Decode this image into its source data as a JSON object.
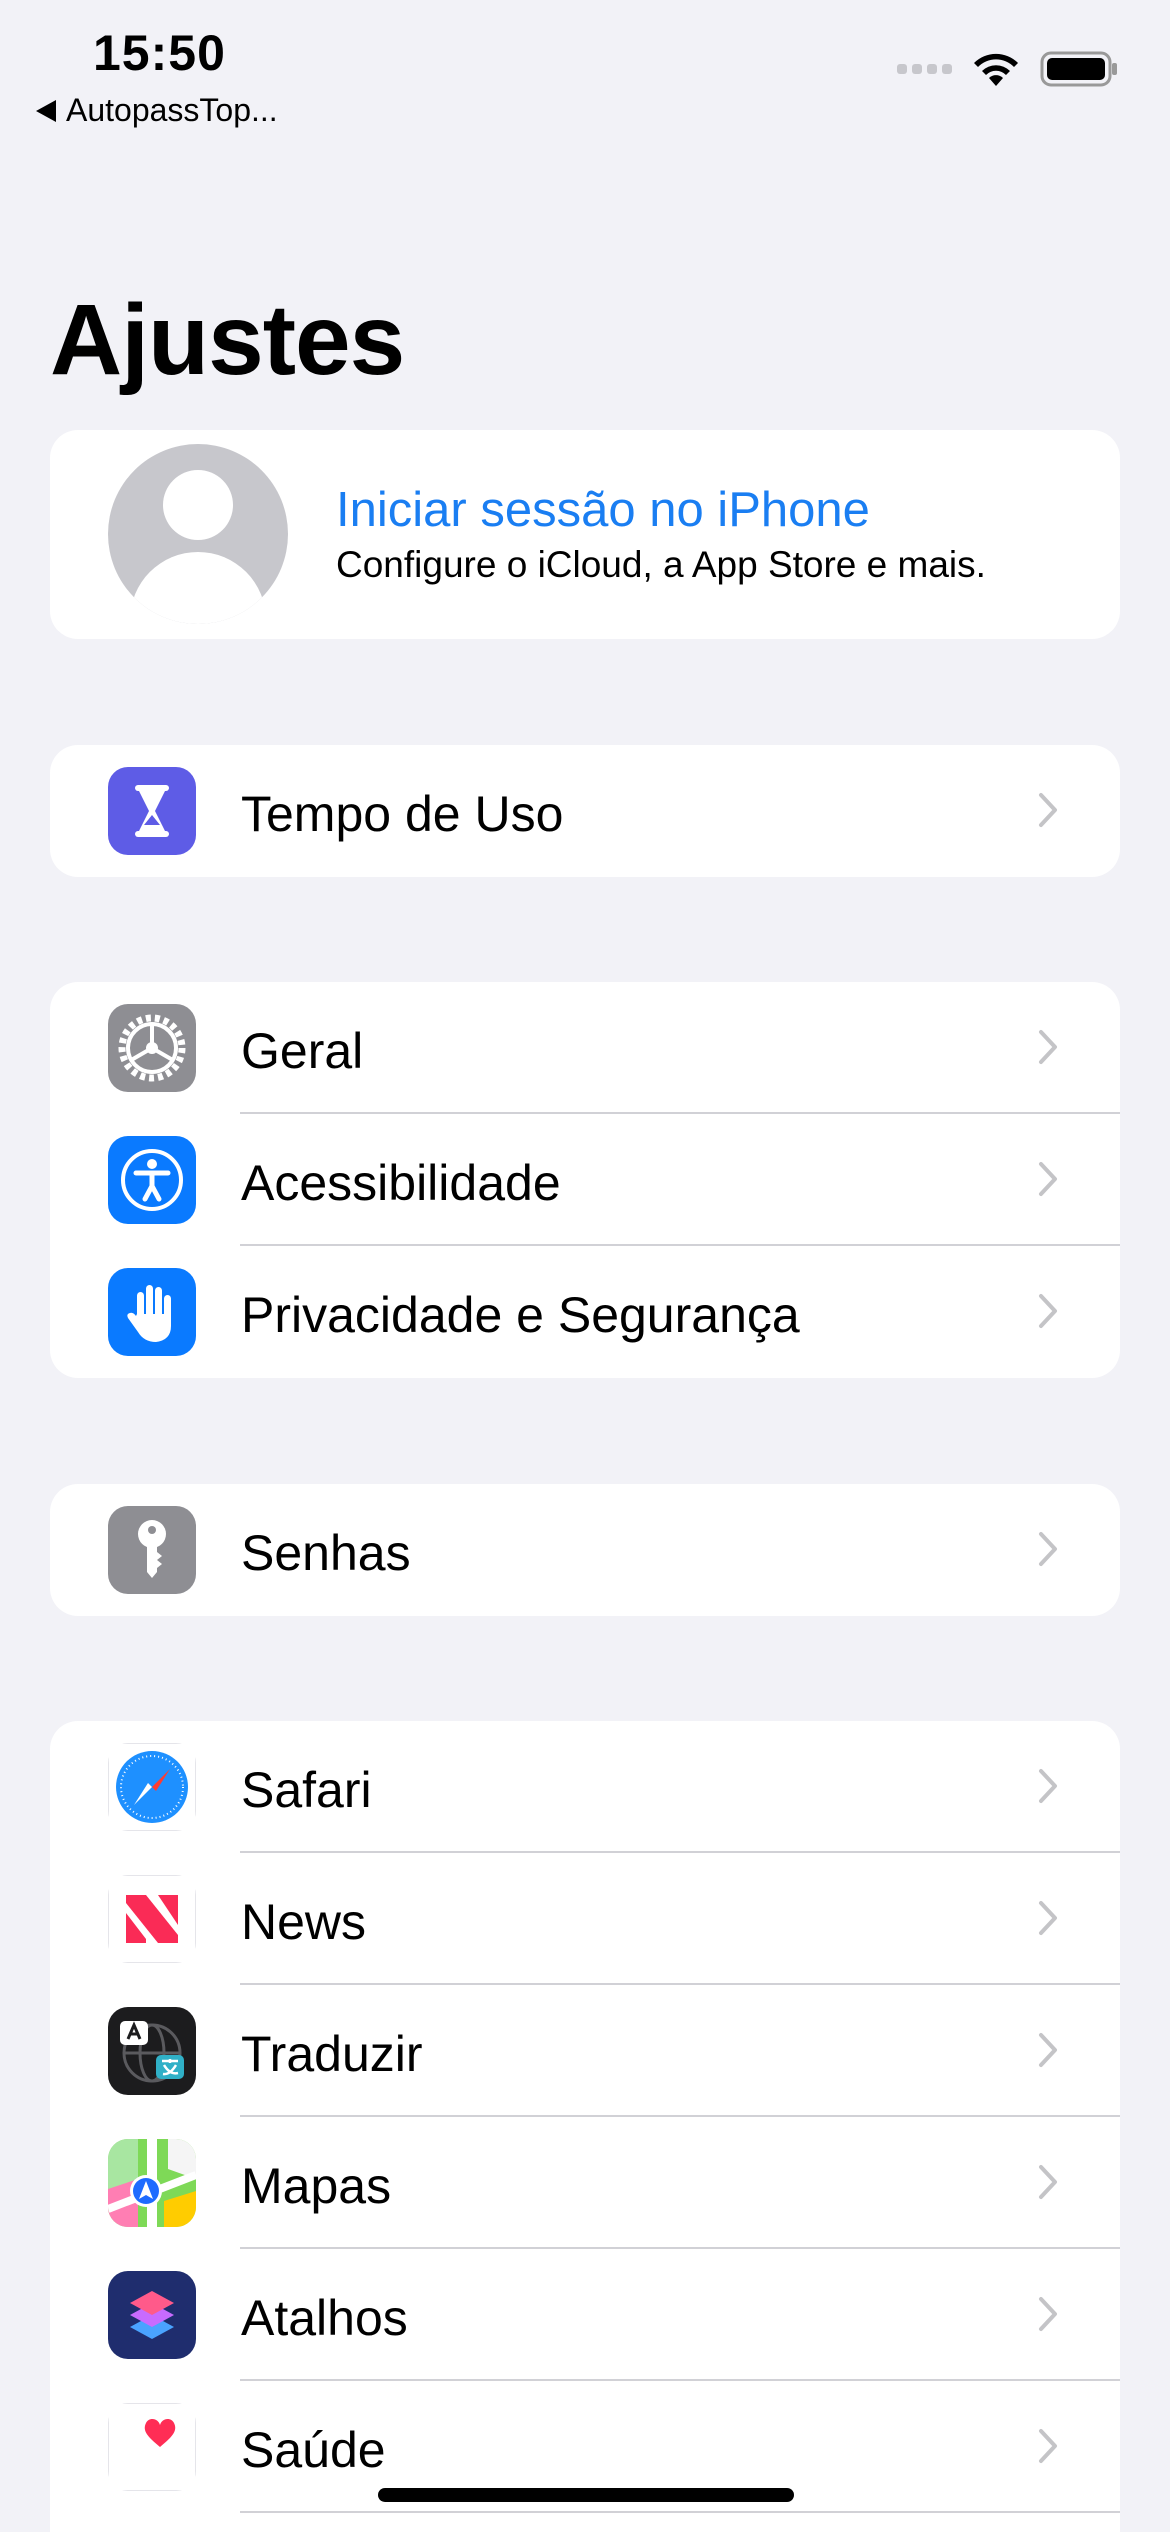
{
  "status_bar": {
    "time": "15:50",
    "back_app": "AutopassTop..."
  },
  "page": {
    "title": "Ajustes"
  },
  "profile": {
    "title": "Iniciar sessão no iPhone",
    "subtitle": "Configure o iCloud, a App Store e mais."
  },
  "groups": {
    "screen_time": {
      "items": [
        {
          "label": "Tempo de Uso",
          "icon": "hourglass-icon"
        }
      ]
    },
    "system": {
      "items": [
        {
          "label": "Geral",
          "icon": "gear-icon"
        },
        {
          "label": "Acessibilidade",
          "icon": "accessibility-icon"
        },
        {
          "label": "Privacidade e Segurança",
          "icon": "hand-icon"
        }
      ]
    },
    "passwords": {
      "items": [
        {
          "label": "Senhas",
          "icon": "key-icon"
        }
      ]
    },
    "apps": {
      "items": [
        {
          "label": "Safari",
          "icon": "safari-compass-icon"
        },
        {
          "label": "News",
          "icon": "news-icon"
        },
        {
          "label": "Traduzir",
          "icon": "translate-icon"
        },
        {
          "label": "Mapas",
          "icon": "maps-icon"
        },
        {
          "label": "Atalhos",
          "icon": "shortcuts-icon"
        },
        {
          "label": "Saúde",
          "icon": "heart-icon"
        }
      ]
    }
  },
  "colors": {
    "background": "#f2f2f7",
    "accent_blue": "#1a7ef2",
    "card": "#ffffff",
    "separator": "#d1d1d6"
  }
}
